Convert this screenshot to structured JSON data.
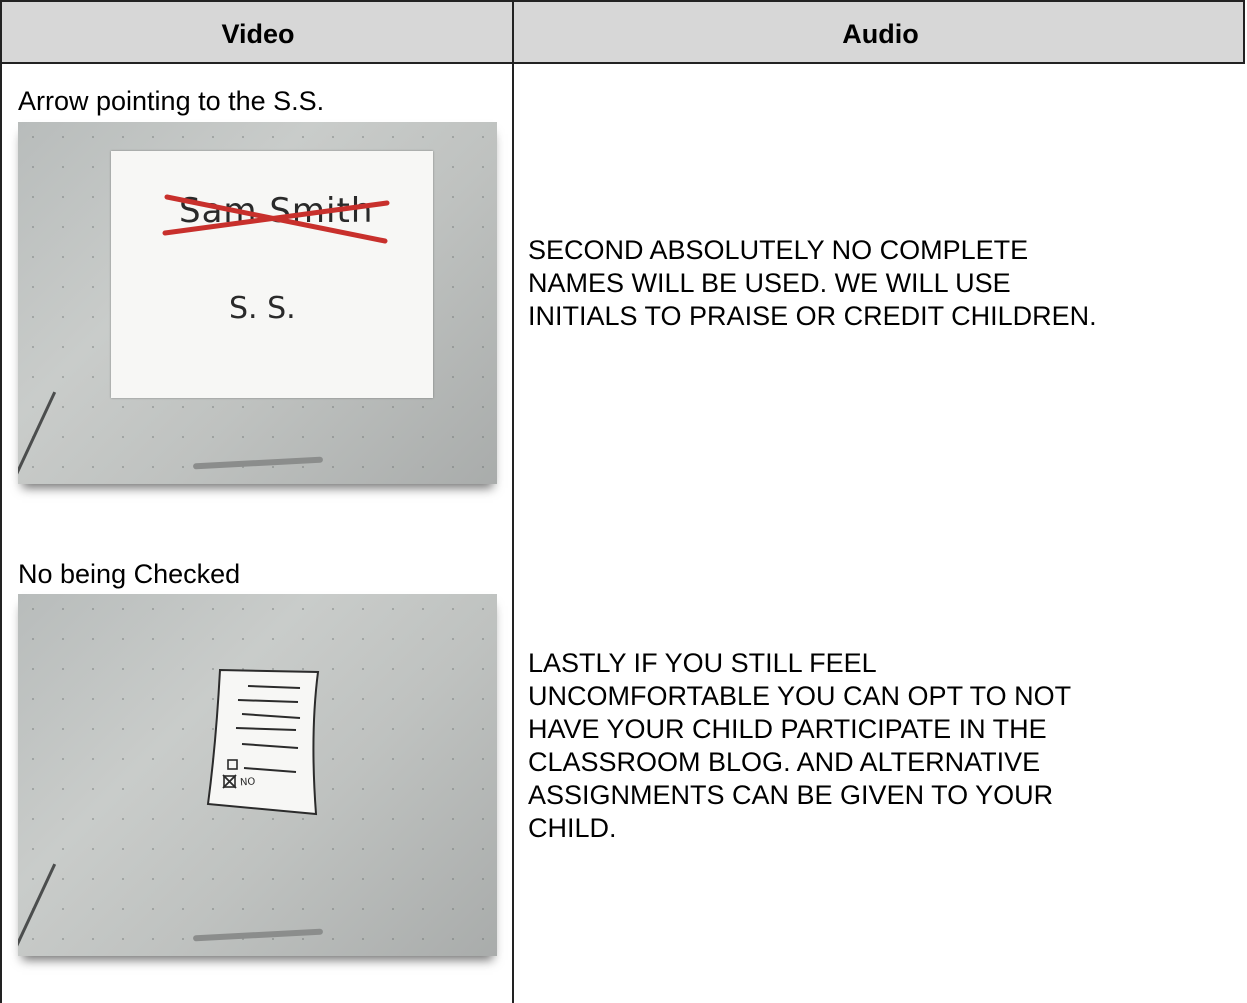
{
  "table": {
    "headers": {
      "video": "Video",
      "audio": "Audio"
    }
  },
  "rows": [
    {
      "video_label": "Arrow pointing to the S.S.",
      "image_text": {
        "struck_name": "Sam Smith",
        "initials": "S. S."
      },
      "audio_lines": [
        "SECOND ABSOLUTELY NO COMPLETE",
        "NAMES WILL BE USED.  WE WILL USE",
        "INITIALS TO PRAISE OR CREDIT CHILDREN."
      ]
    },
    {
      "video_label": "No being Checked",
      "image_text": {
        "checkbox_label": "NO"
      },
      "audio_lines": [
        "LASTLY IF YOU STILL FEEL",
        "UNCOMFORTABLE YOU CAN OPT TO NOT",
        "HAVE YOUR CHILD PARTICIPATE IN THE",
        "CLASSROOM BLOG. AND ALTERNATIVE",
        "ASSIGNMENTS CAN BE GIVEN TO YOUR",
        "CHILD."
      ]
    }
  ],
  "colors": {
    "header_bg": "#d7d7d7",
    "border": "#222222",
    "strike_red": "#c8302c"
  }
}
